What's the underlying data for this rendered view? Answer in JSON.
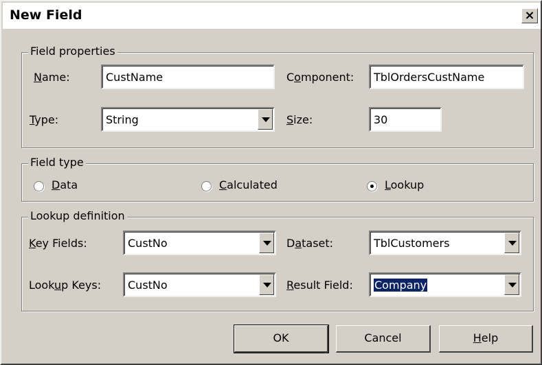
{
  "dialog": {
    "title": "New Field",
    "close_label": "×"
  },
  "field_properties": {
    "legend": "Field properties",
    "name_label": "Name:",
    "name_value": "CustName",
    "component_label": "Component:",
    "component_value": "TblOrdersCustName",
    "type_label": "Type:",
    "type_value": "String",
    "size_label": "Size:",
    "size_value": "30"
  },
  "field_type": {
    "legend": "Field type",
    "options": [
      {
        "label": "Data",
        "selected": false
      },
      {
        "label": "Calculated",
        "selected": false
      },
      {
        "label": "Lookup",
        "selected": true
      }
    ]
  },
  "lookup_definition": {
    "legend": "Lookup definition",
    "key_fields_label": "Key Fields:",
    "key_fields_value": "CustNo",
    "dataset_label": "Dataset:",
    "dataset_value": "TblCustomers",
    "lookup_keys_label": "Lookup Keys:",
    "lookup_keys_value": "CustNo",
    "result_field_label": "Result Field:",
    "result_field_value": "Company"
  },
  "buttons": {
    "ok": "OK",
    "cancel": "Cancel",
    "help": "Help"
  },
  "colors": {
    "face": "#d4d0c8",
    "selection": "#0a246a",
    "title_bg": "#ffffff"
  }
}
